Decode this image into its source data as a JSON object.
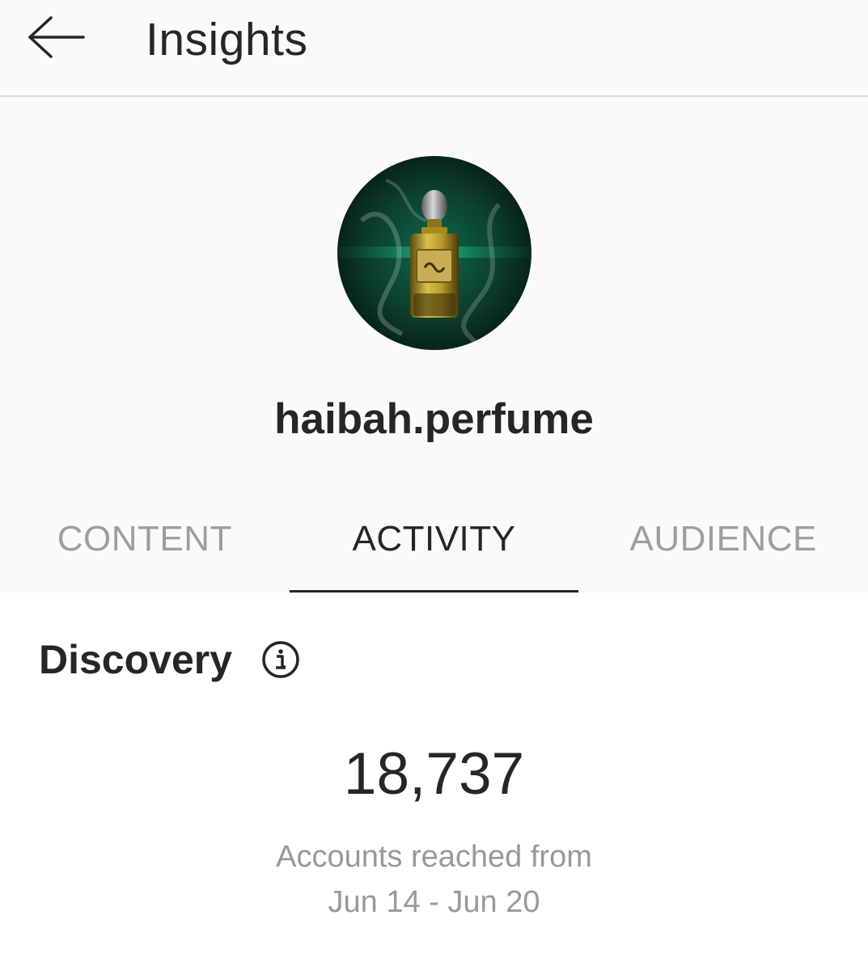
{
  "header": {
    "back_icon": "arrow-left-icon",
    "title": "Insights"
  },
  "profile": {
    "username": "haibah.perfume",
    "avatar_description_icon": "perfume-bottle-avatar"
  },
  "tabs": [
    {
      "label": "CONTENT",
      "active": false
    },
    {
      "label": "ACTIVITY",
      "active": true
    },
    {
      "label": "AUDIENCE",
      "active": false
    }
  ],
  "discovery": {
    "title": "Discovery",
    "info_icon": "info-icon",
    "metric_value": "18,737",
    "metric_caption_line1": "Accounts reached from",
    "metric_caption_line2": "Jun 14 - Jun 20"
  },
  "colors": {
    "background_top": "#fafafa",
    "background_bottom": "#ffffff",
    "text_primary": "#262626",
    "text_inactive_tab": "#9e9e9e",
    "text_caption": "#999999",
    "divider": "#dbdbdb",
    "avatar_green": "#0e4a36"
  }
}
